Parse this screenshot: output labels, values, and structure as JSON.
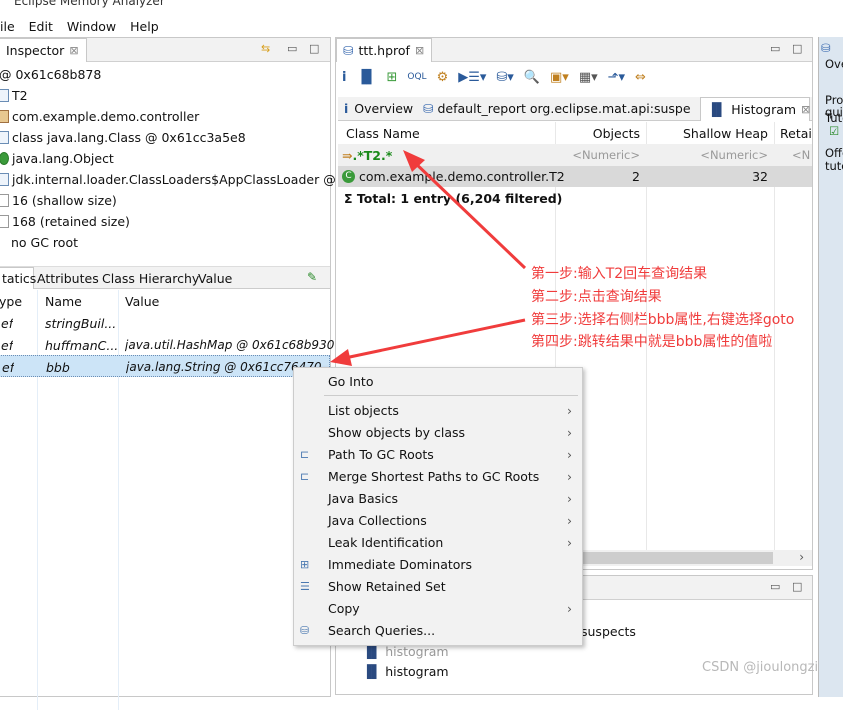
{
  "window": {
    "title": "Eclipse Memory Analyzer"
  },
  "menu": [
    "ile",
    "Edit",
    "Window",
    "Help"
  ],
  "inspector": {
    "tab": "Inspector",
    "items": [
      "0x61c68b878",
      "T2",
      "com.example.demo.controller",
      "class java.lang.Class @ 0x61cc3a5e8",
      "java.lang.Object",
      "jdk.internal.loader.ClassLoaders$AppClassLoader @...",
      "16 (shallow size)",
      "168 (retained size)",
      "no GC root"
    ],
    "tabs": [
      "tatics",
      "Attributes",
      "Class Hierarchy",
      "Value"
    ],
    "columns": [
      "ype",
      "Name",
      "Value"
    ],
    "rows": [
      {
        "type": "ef",
        "name": "stringBuil...",
        "value": ""
      },
      {
        "type": "ef",
        "name": "huffmanC...",
        "value": "java.util.HashMap @ 0x61c68b930"
      },
      {
        "type": "ef",
        "name": "bbb",
        "value": "java.lang.String @ 0x61cc76470",
        "selected": true
      }
    ]
  },
  "editor": {
    "tab": "ttt.hprof",
    "subtabs": [
      "Overview",
      "default_report  org.eclipse.mat.api:suspe...",
      "Histogram"
    ],
    "columns": [
      "Class Name",
      "Objects",
      "Shallow Heap",
      "Retai"
    ],
    "filter": {
      "name": ".*T2.*",
      "objects": "<Numeric>",
      "shallow": "<Numeric>",
      "retained": "<N"
    },
    "rows": [
      {
        "name": "com.example.demo.controller.T2",
        "objects": "2",
        "shallow": "32"
      }
    ],
    "total": "Total: 1 entry (6,204 filtered)"
  },
  "bottom": {
    "items": [
      "suspects",
      "histogram",
      "histogram"
    ]
  },
  "context_menu": [
    {
      "label": "Go Into"
    },
    {
      "label": "List objects",
      "sub": true
    },
    {
      "label": "Show objects by class",
      "sub": true
    },
    {
      "label": "Path To GC Roots",
      "sub": true,
      "icon": "path-icon"
    },
    {
      "label": "Merge Shortest Paths to GC Roots",
      "sub": true,
      "icon": "merge-icon"
    },
    {
      "label": "Java Basics",
      "sub": true
    },
    {
      "label": "Java Collections",
      "sub": true
    },
    {
      "label": "Leak Identification",
      "sub": true
    },
    {
      "label": "Immediate Dominators",
      "icon": "dominator-icon"
    },
    {
      "label": "Show Retained Set",
      "icon": "retained-icon"
    },
    {
      "label": "Copy",
      "sub": true
    },
    {
      "label": "Search Queries...",
      "icon": "search-queries-icon"
    }
  ],
  "notes": [
    "第一步:输入T2回车查询结果",
    "第二步:点击查询结果",
    "第三步:选择右侧栏bbb属性,右键选择goto",
    "第四步:跳转结果中就是bbb属性的值啦"
  ],
  "right_panel": [
    "Ove",
    "Pro",
    "quic",
    "Tuto",
    "Offe",
    "tuto"
  ],
  "watermark": "CSDN @jioulongzi",
  "colors": {
    "annotation": "#f03c3c",
    "selection": "#cce4f7",
    "filter_text": "#1a8a1a"
  }
}
